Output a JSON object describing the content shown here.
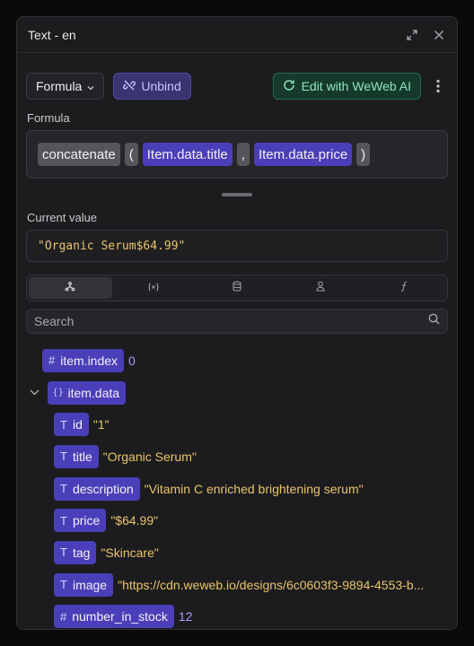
{
  "panel": {
    "title": "Text - en"
  },
  "toolbar": {
    "mode_label": "Formula",
    "unbind_label": "Unbind",
    "ai_label": "Edit with WeWeb AI"
  },
  "formula": {
    "label": "Formula",
    "tokens": {
      "fn": "concatenate",
      "open": "(",
      "arg1": "Item.data.title",
      "comma": ",",
      "arg2": "Item.data.price",
      "close": ")"
    }
  },
  "current": {
    "label": "Current value",
    "value": "\"Organic Serum$64.99\""
  },
  "search": {
    "placeholder": "Search"
  },
  "tree": {
    "index": {
      "type": "#",
      "name": "item.index",
      "value": "0"
    },
    "data": {
      "type": "{ }",
      "name": "item.data"
    },
    "fields": [
      {
        "type": "T",
        "name": "id",
        "value": "\"1\""
      },
      {
        "type": "T",
        "name": "title",
        "value": "\"Organic Serum\""
      },
      {
        "type": "T",
        "name": "description",
        "value": "\"Vitamin C enriched brightening serum\""
      },
      {
        "type": "T",
        "name": "price",
        "value": "\"$64.99\""
      },
      {
        "type": "T",
        "name": "tag",
        "value": "\"Skincare\""
      },
      {
        "type": "T",
        "name": "image",
        "value": "\"https://cdn.weweb.io/designs/6c0603f3-9894-4553-b..."
      },
      {
        "type": "#",
        "name": "number_in_stock",
        "value": "12"
      }
    ]
  },
  "colors": {
    "accent": "#4a3fb8",
    "string_value": "#e9c46a",
    "number_value": "#a99cff",
    "ai_green": "#8fe3bc"
  }
}
